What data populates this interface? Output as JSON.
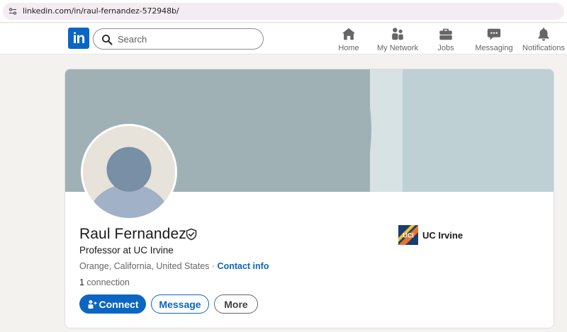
{
  "browser": {
    "url": "linkedin.com/in/raul-fernandez-572948b/"
  },
  "nav": {
    "logo_text": "in",
    "search_placeholder": "Search",
    "items": [
      {
        "label": "Home",
        "icon": "home-icon"
      },
      {
        "label": "My Network",
        "icon": "people-icon"
      },
      {
        "label": "Jobs",
        "icon": "briefcase-icon"
      },
      {
        "label": "Messaging",
        "icon": "chat-bubble-icon"
      },
      {
        "label": "Notifications",
        "icon": "bell-icon"
      }
    ]
  },
  "profile": {
    "name": "Raul Fernandez",
    "headline": "Professor at UC Irvine",
    "location": "Orange, California, United States",
    "location_separator": " · ",
    "contact_info_label": "Contact info",
    "connection_count": "1",
    "connection_label": " connection",
    "company": {
      "name": "UC Irvine",
      "logo_text": "UCI"
    },
    "buttons": {
      "connect": "Connect",
      "message": "Message",
      "more": "More"
    }
  },
  "colors": {
    "brand_blue": "#0a66c2",
    "banner": "#a0b1b6",
    "page_bg": "#f4f2ee"
  }
}
